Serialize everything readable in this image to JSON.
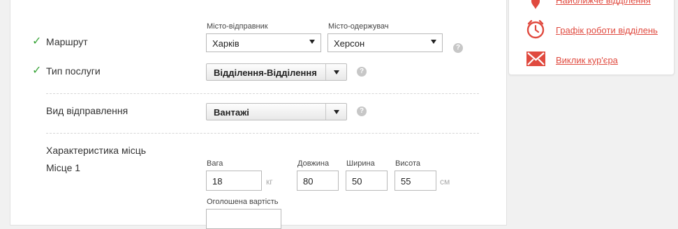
{
  "form": {
    "route": {
      "label": "Маршрут",
      "sender_city_label": "Місто-відправник",
      "sender_city_value": "Харків",
      "receiver_city_label": "Місто-одержувач",
      "receiver_city_value": "Херсон"
    },
    "service_type": {
      "label": "Тип послуги",
      "value": "Відділення-Відділення"
    },
    "shipment_type": {
      "label": "Вид відправлення",
      "value": "Вантажі"
    },
    "places": {
      "title": "Характеристика місць",
      "place_label": "Місце 1",
      "weight_label": "Вага",
      "weight_value": "18",
      "weight_unit": "кг",
      "length_label": "Довжина",
      "length_value": "80",
      "width_label": "Ширина",
      "width_value": "50",
      "height_label": "Висота",
      "height_value": "55",
      "dim_unit": "см",
      "declared_value_label": "Оголошена вартість"
    },
    "help_glyph": "?"
  },
  "sidebar": {
    "items": [
      {
        "label": "Найближче відділення",
        "icon": "location-pin-icon"
      },
      {
        "label": "Графік роботи відділень",
        "icon": "clock-icon"
      },
      {
        "label": "Виклик кур'єра",
        "icon": "envelope-icon"
      }
    ]
  },
  "colors": {
    "accent": "#e04a3f",
    "check": "#3aa53a",
    "help": "#c7c7c7"
  }
}
